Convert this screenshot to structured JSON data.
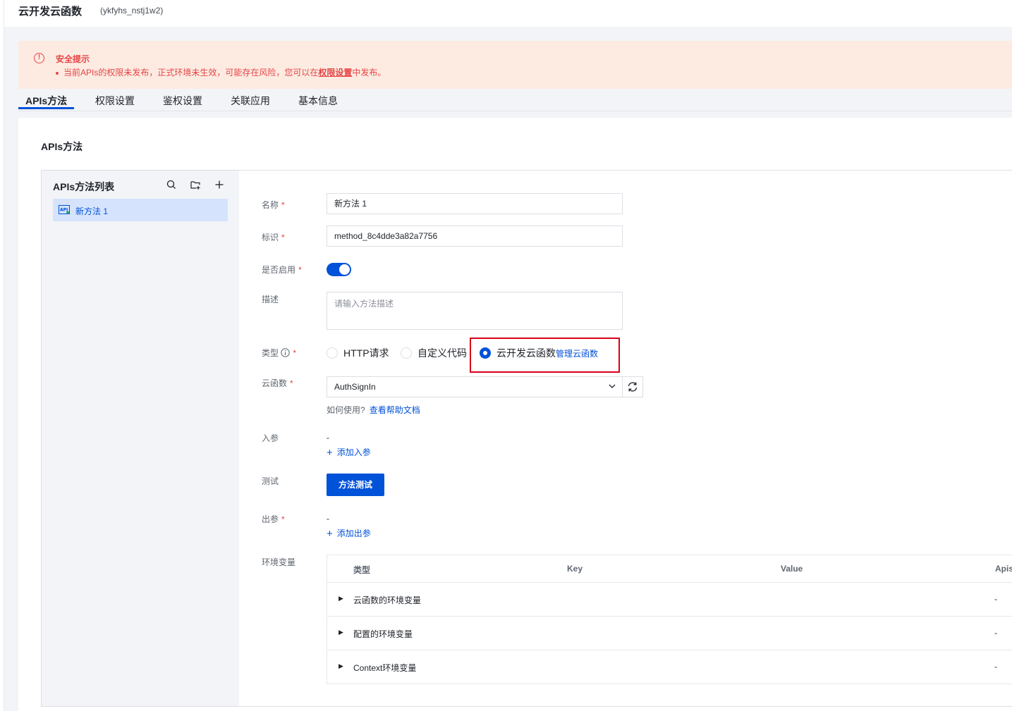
{
  "header": {
    "title": "云开发云函数",
    "env_id": "(ykfyhs_nstj1w2)"
  },
  "alert": {
    "icon": "alert-circle-icon",
    "title": "安全提示",
    "text_before": "当前APIs的权限未发布，正式环境未生效，可能存在风险，您可以在",
    "link": "权限设置",
    "text_after": "中发布。"
  },
  "tabs": [
    "APIs方法",
    "权限设置",
    "鉴权设置",
    "关联应用",
    "基本信息"
  ],
  "section_title": "APIs方法",
  "sidebar": {
    "title": "APIs方法列表",
    "icons": [
      "search-icon",
      "folder-add-icon",
      "plus-icon"
    ],
    "items": [
      {
        "label": "新方法 1",
        "icon": "api-icon"
      }
    ]
  },
  "form": {
    "name_label": "名称",
    "name_value": "新方法 1",
    "id_label": "标识",
    "id_value": "method_8c4dde3a82a7756",
    "enabled_label": "是否启用",
    "enabled": true,
    "desc_label": "描述",
    "desc_placeholder": "请输入方法描述",
    "type_label": "类型",
    "type_options": [
      "HTTP请求",
      "自定义代码",
      "云开发云函数"
    ],
    "type_selected": "云开发云函数",
    "manage_link": "管理云函数",
    "func_label": "云函数",
    "func_value": "AuthSignIn",
    "help_text": "如何使用?",
    "help_link": "查看帮助文档",
    "input_label": "入参",
    "input_value": "-",
    "add_input": "添加入参",
    "test_label": "测试",
    "test_button": "方法测试",
    "output_label": "出参",
    "output_value": "-",
    "add_output": "添加出参",
    "env_label": "环境变量"
  },
  "env_table": {
    "columns": [
      "类型",
      "Key",
      "Value",
      "Apis"
    ],
    "rows": [
      {
        "label": "云函数的环境变量",
        "value": "-"
      },
      {
        "label": "配置的环境变量",
        "value": "-"
      },
      {
        "label": "Context环境变量",
        "value": "-"
      }
    ]
  },
  "colors": {
    "primary": "#0052d9",
    "danger": "#e54545",
    "alert_bg": "#fdebe2",
    "highlight": "#d9001b"
  }
}
